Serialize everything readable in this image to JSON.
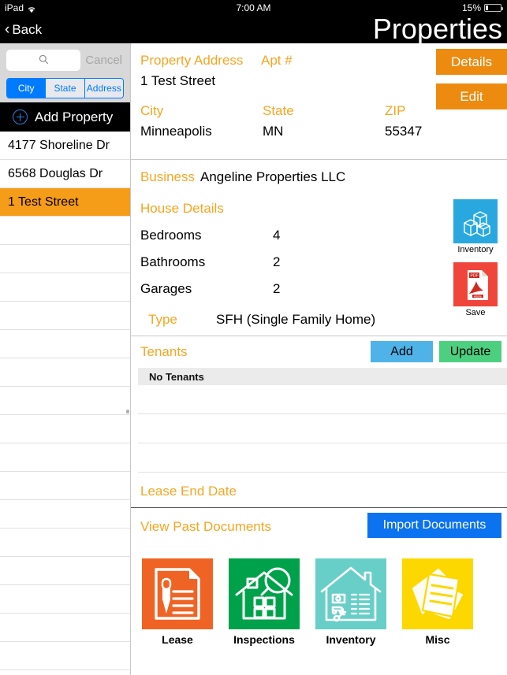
{
  "statusbar": {
    "device": "iPad",
    "wifi_icon": "wifi-icon",
    "time": "7:00 AM",
    "battery_percent": "15%",
    "battery_icon": "battery-icon"
  },
  "navbar": {
    "back_label": "Back",
    "back_icon": "chevron-left-icon",
    "title": "Properties"
  },
  "sidebar": {
    "search": {
      "value": "",
      "placeholder": "",
      "icon": "search-icon"
    },
    "cancel_label": "Cancel",
    "segments": [
      {
        "label": "City",
        "active": true
      },
      {
        "label": "State",
        "active": false
      },
      {
        "label": "Address",
        "active": false
      }
    ],
    "add_property": {
      "label": "Add Property",
      "icon": "plus-circle-icon"
    },
    "properties": [
      {
        "label": "4177 Shoreline Dr",
        "selected": false
      },
      {
        "label": "6568 Douglas Dr",
        "selected": false
      },
      {
        "label": "1 Test Street",
        "selected": true
      }
    ],
    "empty_row_count": 16
  },
  "main": {
    "address": {
      "label_address": "Property Address",
      "label_apt": "Apt #",
      "value_address": "1 Test Street",
      "value_apt": "",
      "label_city": "City",
      "label_state": "State",
      "label_zip": "ZIP",
      "value_city": "Minneapolis",
      "value_state": "MN",
      "value_zip": "55347",
      "details_button": "Details",
      "edit_button": "Edit"
    },
    "business": {
      "label": "Business",
      "value": "Angeline Properties LLC"
    },
    "house_details": {
      "title": "House Details",
      "rows": [
        {
          "label": "Bedrooms",
          "value": "4"
        },
        {
          "label": "Bathrooms",
          "value": "2"
        },
        {
          "label": "Garages",
          "value": "2"
        }
      ],
      "type_label": "Type",
      "type_value": "SFH (Single Family Home)"
    },
    "side_actions": [
      {
        "caption": "Inventory",
        "icon": "inventory-boxes-icon",
        "color": "#29a8e0"
      },
      {
        "caption": "Save",
        "icon": "pdf-save-icon",
        "color": "#f0453a"
      }
    ],
    "tenants": {
      "title": "Tenants",
      "add_button": "Add",
      "update_button": "Update",
      "empty_header": "No Tenants",
      "empty_row_count": 3
    },
    "lease": {
      "title": "Lease End Date",
      "value": ""
    },
    "documents": {
      "title": "View Past Documents",
      "import_button": "Import Documents",
      "items": [
        {
          "caption": "Lease",
          "icon": "lease-document-icon",
          "color": "#ef6425"
        },
        {
          "caption": "Inspections",
          "icon": "house-magnifier-icon",
          "color": "#00a14b"
        },
        {
          "caption": "Inventory",
          "icon": "house-inventory-icon",
          "color": "#68cfc8"
        },
        {
          "caption": "Misc",
          "icon": "misc-papers-icon",
          "color": "#fdd700"
        }
      ]
    }
  },
  "colors": {
    "accent_orange": "#f5a623",
    "button_orange": "#ed8b11",
    "selected_row": "#f59c18",
    "blue": "#007aff",
    "add_blue": "#4fb3e8",
    "update_green": "#4cd080",
    "import_blue": "#0b72f0"
  }
}
